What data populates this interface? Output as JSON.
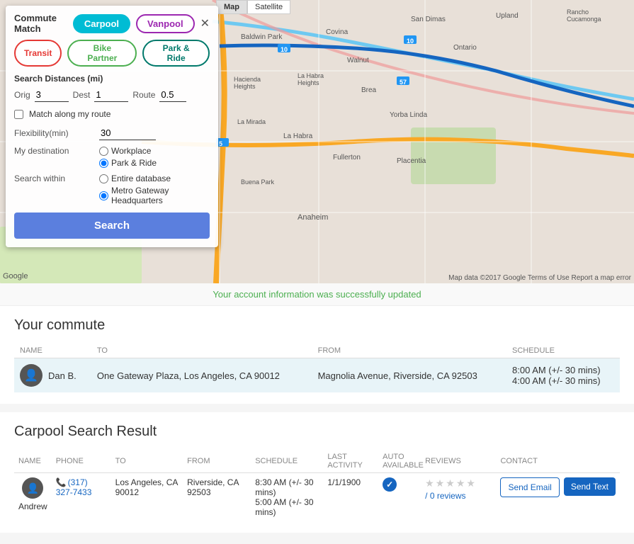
{
  "map": {
    "tabs": [
      "Map",
      "Satellite"
    ],
    "attribution": "Map data ©2017 Google   Terms of Use   Report a map error"
  },
  "panel": {
    "title": "Commute Match",
    "carpool_label": "Carpool",
    "vanpool_label": "Vanpool",
    "transit_label": "Transit",
    "bike_partner_label": "Bike Partner",
    "park_ride_label": "Park & Ride",
    "distances_label": "Search Distances (mi)",
    "orig_label": "Orig",
    "orig_value": "3",
    "dest_label": "Dest",
    "dest_value": "1",
    "route_label": "Route",
    "route_value": "0.5",
    "match_route_label": "Match along my route",
    "flexibility_label": "Flexibility(min)",
    "flexibility_value": "30",
    "my_destination_label": "My destination",
    "destination_option1": "Workplace",
    "destination_option2": "Park & Ride",
    "search_within_label": "Search within",
    "search_within_option1": "Entire database",
    "search_within_option2": "Metro Gateway Headquarters",
    "search_button_label": "Search"
  },
  "success_message": "Your account information was successfully updated",
  "your_commute": {
    "title": "Your commute",
    "columns": [
      "NAME",
      "TO",
      "FROM",
      "SCHEDULE"
    ],
    "rows": [
      {
        "name": "Dan B.",
        "to": "One Gateway Plaza, Los Angeles, CA 90012",
        "from": "Magnolia Avenue, Riverside, CA 92503",
        "schedule_line1": "8:00 AM (+/- 30 mins)",
        "schedule_line2": "4:00 AM (+/- 30 mins)"
      }
    ]
  },
  "carpool_result": {
    "title": "Carpool Search Result",
    "columns": [
      "NAME",
      "PHONE",
      "TO",
      "FROM",
      "SCHEDULE",
      "LAST ACTIVITY",
      "AUTO AVAILABLE",
      "REVIEWS",
      "CONTACT"
    ],
    "rows": [
      {
        "name": "Andrew",
        "phone": "(317) 327-7433",
        "to": "Los Angeles, CA 90012",
        "from": "Riverside, CA 92503",
        "schedule_line1": "8:30 AM (+/- 30 mins)",
        "schedule_line2": "5:00 AM (+/- 30 mins)",
        "last_activity": "1/1/1900",
        "auto_available": true,
        "reviews_count": "/ 0 reviews",
        "send_email_label": "Send Email",
        "send_text_label": "Send Text"
      }
    ]
  }
}
